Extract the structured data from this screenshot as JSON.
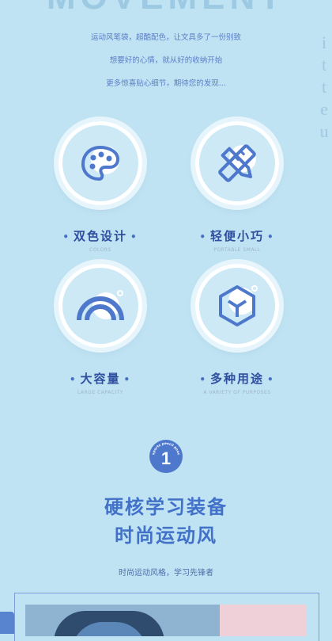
{
  "header": {
    "bg_word": "MOVEMENT",
    "side_letters": [
      "i",
      "t",
      "t",
      "e",
      "u"
    ]
  },
  "intro": {
    "lines": [
      "运动风笔袋，超酷配色，让文具多了一份别致",
      "想要好的心情，就从好的收纳开始",
      "更多惊喜贴心细节，期待您的发现..."
    ]
  },
  "features": [
    {
      "title": "双色设计",
      "subtitle": "COLORS",
      "icon": "palette-icon"
    },
    {
      "title": "轻便小巧",
      "subtitle": "PORTABLE SMALL",
      "icon": "ruler-pencil-icon"
    },
    {
      "title": "大容量",
      "subtitle": "LARGE CAPACITY",
      "icon": "rainbow-icon"
    },
    {
      "title": "多种用途",
      "subtitle": "A VARIETY OF PURPOSES",
      "icon": "cube-icon"
    }
  ],
  "section": {
    "badge_number": "1",
    "badge_ring_text": "sports pencil pouch",
    "headline_1": "硬核学习装备",
    "headline_2": "时尚运动风",
    "tagline": "时尚运动风格，学习先锋者"
  },
  "colors": {
    "background": "#bfe3f2",
    "accent": "#4d78cc",
    "title": "#2f4f9e"
  }
}
